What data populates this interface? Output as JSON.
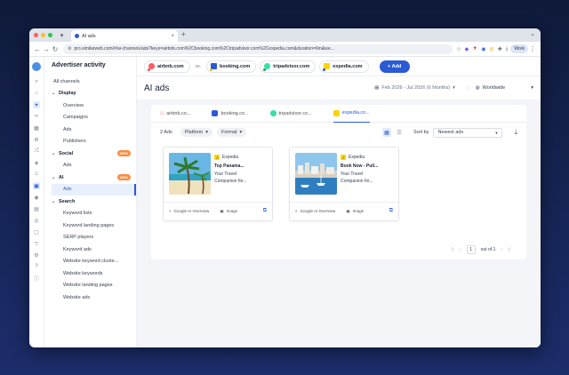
{
  "browser": {
    "tab_title": "AI ads",
    "url": "pro.similarweb.com/#/ai-channels/ads?keys=airbnb.com%2Cbooking.com%2Ctripadvisor.com%2Cexpedia.com&duration=6m&we...",
    "profile": "Work",
    "colors": {
      "close": "#ff5f57",
      "min": "#febc2e",
      "max": "#28c840"
    }
  },
  "topbar": {
    "competitors": [
      {
        "name": "airbnb.com",
        "color": "#ff5a5f",
        "dot": "#e05454"
      },
      {
        "name": "booking.com",
        "color": "#2a5bd7",
        "dot": "#f2b02a"
      },
      {
        "name": "tripadvisor.com",
        "color": "#34e0a1",
        "dot": "#20a35a"
      },
      {
        "name": "expedia.com",
        "color": "#fbd406",
        "dot": "#2a5bd7"
      }
    ],
    "vs_label": "vs.",
    "add_label": "Add"
  },
  "sidebar": {
    "title": "Advertiser activity",
    "all_channels": "All channels",
    "display": {
      "label": "Display",
      "items": [
        "Overview",
        "Campaigns",
        "Ads",
        "Publishers"
      ]
    },
    "social": {
      "label": "Social",
      "badge": "NEW",
      "items": [
        "Ads"
      ]
    },
    "ai": {
      "label": "AI",
      "badge": "NEW",
      "items": [
        "Ads"
      ]
    },
    "search": {
      "label": "Search",
      "items": [
        "Keyword lists",
        "Keyword landing pages",
        "SERP players",
        "Keyword ads",
        "Website keyword cluste...",
        "Website keywords",
        "Website landing pages",
        "Website ads"
      ]
    }
  },
  "header": {
    "title": "AI ads",
    "date_range": "Feb 2026 - Jul 2026 (6 Months)",
    "region": "Worldwide"
  },
  "content_tabs": [
    {
      "label": "airbnb.co...",
      "color": "#ff5a5f"
    },
    {
      "label": "booking.co...",
      "color": "#2a5bd7"
    },
    {
      "label": "tripadvisor.co...",
      "color": "#34e0a1"
    },
    {
      "label": "expedia.co...",
      "color": "#fbd406"
    }
  ],
  "filters": {
    "count": "2 Ads",
    "platform": "Platform",
    "format": "Format",
    "sort_label": "Sort by",
    "sort_value": "Newest ads"
  },
  "cards": [
    {
      "advertiser": "Expedia",
      "title": "Top Panama...",
      "line1": "Your Travel",
      "line2": "Companion for...",
      "platform": "Google AI Overview",
      "format": "Image"
    },
    {
      "advertiser": "Expedia",
      "title": "Book Now - Pull...",
      "line1": "Your Travel",
      "line2": "Companion for...",
      "platform": "Google AI Overview",
      "format": "Image"
    }
  ],
  "pagination": {
    "page": "1",
    "of_label": "out of 1"
  }
}
